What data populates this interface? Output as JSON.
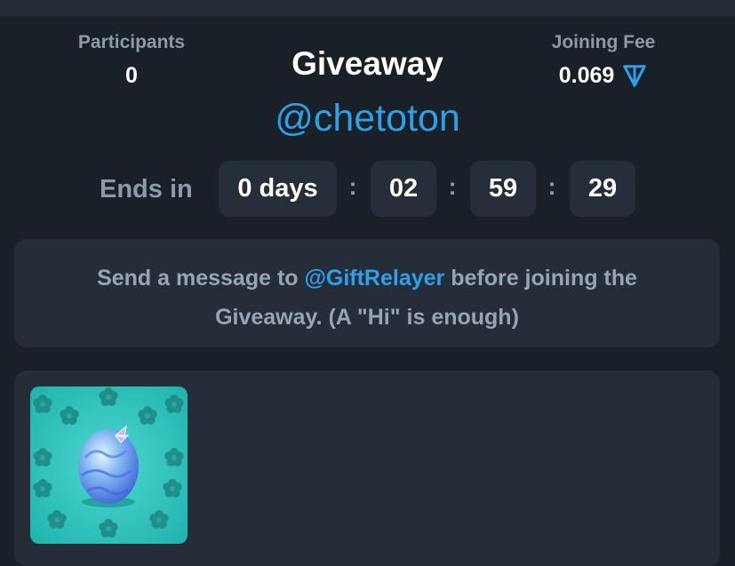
{
  "stats": {
    "participants_label": "Participants",
    "participants_value": "0",
    "fee_label": "Joining Fee",
    "fee_value": "0.069",
    "fee_currency_icon": "ton-icon"
  },
  "header": {
    "title": "Giveaway",
    "channel": "@chetoton"
  },
  "countdown": {
    "label": "Ends in",
    "days": "0 days",
    "hours": "02",
    "minutes": "59",
    "seconds": "29",
    "separator": ":"
  },
  "notice": {
    "text_before": "Send a message to ",
    "link": "@GiftRelayer",
    "text_after": " before joining the Giveaway. (A \"Hi\" is enough)"
  },
  "prize": {
    "image_icon": "egg-gift-icon"
  },
  "colors": {
    "background": "#1a2028",
    "card": "#242d38",
    "accent": "#2ea0ea",
    "muted_text": "#8d9aa8",
    "prize_bg": "#2ec4c0"
  }
}
